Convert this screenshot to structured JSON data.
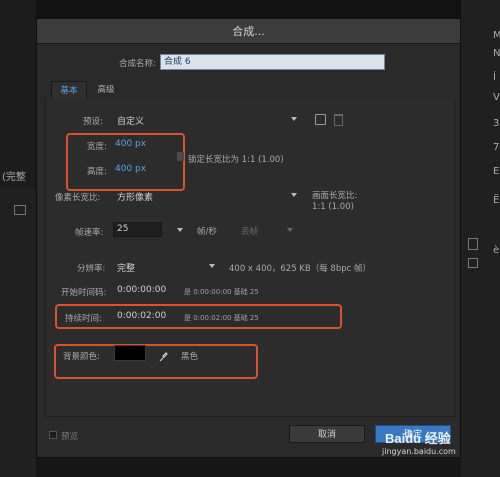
{
  "dialog": {
    "title": "合成...",
    "name_label": "合成名称:",
    "name_value": "合成 6",
    "tabs": [
      "基本",
      "高级"
    ],
    "preset": {
      "label": "预设:",
      "value": "自定义"
    },
    "width": {
      "label": "宽度:",
      "value": "400 px"
    },
    "height": {
      "label": "高度:",
      "value": "400 px"
    },
    "lock_aspect": "锁定长宽比为 1:1 (1.00)",
    "pixel_aspect": {
      "label": "像素长宽比:",
      "value": "方形像素"
    },
    "frame_aspect": {
      "label": "画面长宽比:",
      "value": "1:1 (1.00)"
    },
    "frame_rate": {
      "label": "帧速率:",
      "value": "25",
      "unit": "帧/秒",
      "drop_frame": "丢帧"
    },
    "resolution": {
      "label": "分辨率:",
      "value": "完整",
      "info": "400 x 400，625 KB（每 8bpc 帧）"
    },
    "start_timecode": {
      "label": "开始时间码:",
      "value": "0:00:00:00",
      "info": "是 0:00:00:00  基础 25"
    },
    "duration": {
      "label": "持续时间:",
      "value": "0:00:02:00",
      "info": "是 0:00:02:00  基础 25"
    },
    "bg_color": {
      "label": "背景颜色:",
      "value": "黑色",
      "swatch": "#000000"
    },
    "preview_label": "预览",
    "cancel_label": "取消",
    "ok_label": "确定"
  },
  "side": {
    "left_tab": "(完整",
    "right_letters": [
      "M",
      "N",
      "Í",
      "æ",
      "V",
      "3",
      "7",
      "E",
      "Ë",
      "õ",
      "è",
      "ì"
    ]
  },
  "watermark": {
    "brand": "Baidu 经验",
    "url": "jingyan.baidu.com"
  },
  "colors": {
    "accent_blue": "#5aa4e8",
    "highlight_red": "#d8532a",
    "ok_button": "#3a78c2"
  }
}
